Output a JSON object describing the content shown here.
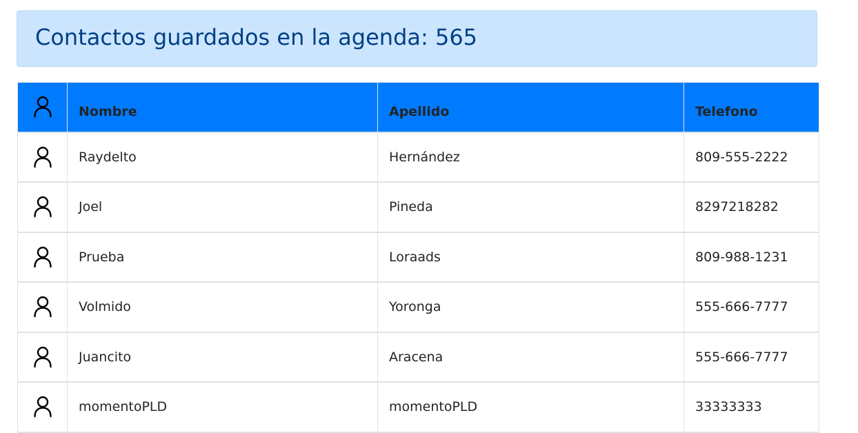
{
  "header": {
    "title": "Contactos guardados en la agenda: 565",
    "background_color": "#cce5ff",
    "text_color": "#004085"
  },
  "table": {
    "header_color": "#007bff",
    "columns": {
      "icon": "person-icon",
      "nombre": "Nombre",
      "apellido": "Apellido",
      "telefono": "Telefono"
    },
    "rows": [
      {
        "icon": "person-icon",
        "nombre": "Raydelto",
        "apellido": "Hernández",
        "telefono": "809-555-2222"
      },
      {
        "icon": "person-icon",
        "nombre": "Joel",
        "apellido": "Pineda",
        "telefono": "8297218282"
      },
      {
        "icon": "person-icon",
        "nombre": "Prueba",
        "apellido": "Loraads",
        "telefono": "809-988-1231"
      },
      {
        "icon": "person-icon",
        "nombre": "Volmido",
        "apellido": "Yoronga",
        "telefono": "555-666-7777"
      },
      {
        "icon": "person-icon",
        "nombre": "Juancito",
        "apellido": "Aracena",
        "telefono": "555-666-7777"
      },
      {
        "icon": "person-icon",
        "nombre": "momentoPLD",
        "apellido": "momentoPLD",
        "telefono": "33333333"
      }
    ]
  }
}
